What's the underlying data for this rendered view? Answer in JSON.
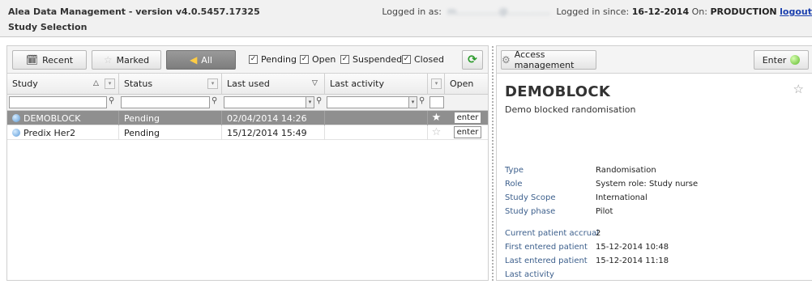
{
  "header": {
    "app_title": "Alea Data Management - version v4.0.5457.17325",
    "subtitle": "Study Selection",
    "logged_in_label": "Logged in as:",
    "user_email": "m...............@...............",
    "since_label": "Logged in since:",
    "since_value": "16-12-2014",
    "on_label": "On:",
    "environment": "PRODUCTION",
    "logout": "logout"
  },
  "toolbar": {
    "recent": "Recent",
    "marked": "Marked",
    "all": "All",
    "filters": [
      {
        "label": "Pending",
        "checked": true
      },
      {
        "label": "Open",
        "checked": true
      },
      {
        "label": "Suspended",
        "checked": true
      },
      {
        "label": "Closed",
        "checked": true
      }
    ]
  },
  "grid": {
    "columns": [
      "Study",
      "Status",
      "Last used",
      "Last activity",
      "Open"
    ],
    "rows": [
      {
        "study": "DEMOBLOCK",
        "status": "Pending",
        "last_used": "02/04/2014 14:26",
        "last_activity": "",
        "starred": true,
        "action": "enter",
        "selected": true
      },
      {
        "study": "Predix Her2",
        "status": "Pending",
        "last_used": "15/12/2014 15:49",
        "last_activity": "",
        "starred": false,
        "action": "enter",
        "selected": false
      }
    ]
  },
  "detail": {
    "access_management": "Access management",
    "enter": "Enter",
    "title": "DEMOBLOCK",
    "description": "Demo blocked randomisation",
    "props1": [
      {
        "key": "Type",
        "value": "Randomisation"
      },
      {
        "key": "Role",
        "value": "System role: Study nurse"
      },
      {
        "key": "Study Scope",
        "value": "International"
      },
      {
        "key": "Study phase",
        "value": "Pilot"
      }
    ],
    "props2": [
      {
        "key": "Current patient accrual",
        "value": "2"
      },
      {
        "key": "First entered patient",
        "value": "15-12-2014 10:48"
      },
      {
        "key": "Last entered patient",
        "value": "15-12-2014 11:18"
      },
      {
        "key": "Last activity",
        "value": ""
      }
    ]
  },
  "colors": {
    "selected_row": "#8f8f8f",
    "link": "#1a3fae",
    "property_key": "#3c5f8c",
    "enter_green": "#5cb82a"
  }
}
